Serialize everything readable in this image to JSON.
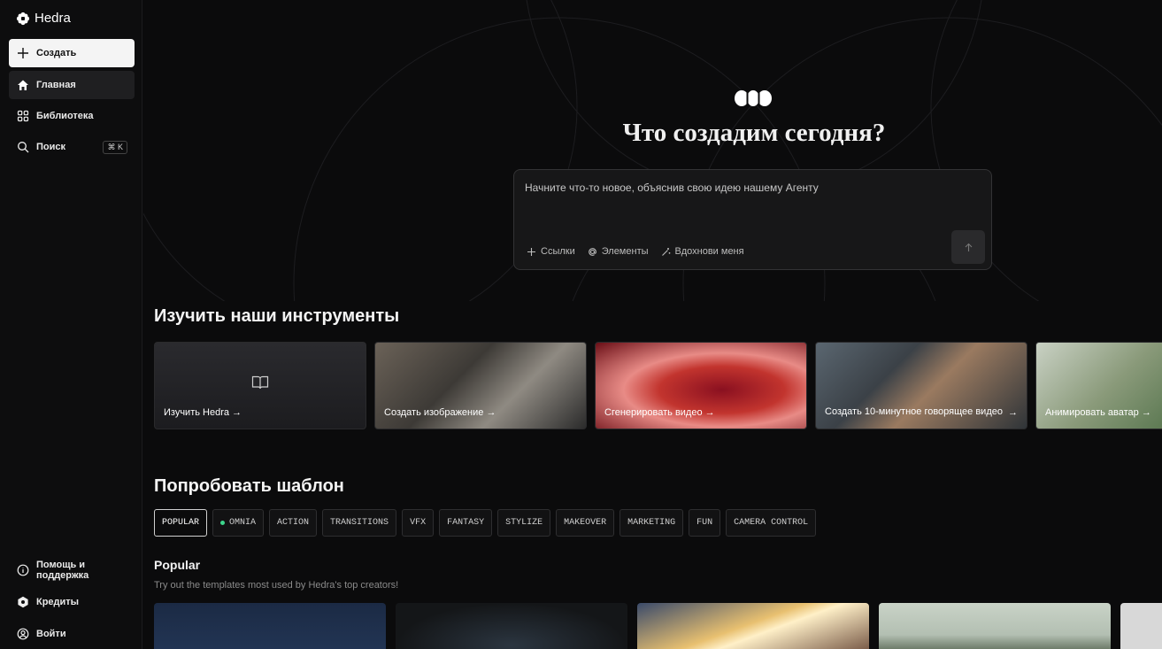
{
  "sidebar": {
    "brand": "Hedra",
    "create": "Создать",
    "home": "Главная",
    "library": "Библиотека",
    "search": "Поиск",
    "search_shortcut": "⌘ K",
    "help": "Помощь и поддержка",
    "credits": "Кредиты",
    "login": "Войти"
  },
  "hero": {
    "title": "Что создадим сегодня?",
    "prompt_placeholder": "Начните что-то новое, объяснив свою идею нашему Агенту",
    "tools": {
      "links": "Ссылки",
      "elements": "Элементы",
      "inspire": "Вдохнови меня"
    }
  },
  "tools_section": {
    "title": "Изучить наши инструменты",
    "cards": [
      {
        "label": "Изучить Hedra →"
      },
      {
        "label": "Создать изображение →"
      },
      {
        "label": "Сгенерировать видео →"
      },
      {
        "label": "Создать 10-минутное говорящее видео",
        "arrow": "→"
      },
      {
        "label": "Анимировать аватар →"
      }
    ]
  },
  "templates_section": {
    "title": "Попробовать шаблон",
    "chips": [
      "POPULAR",
      "OMNIA",
      "ACTION",
      "TRANSITIONS",
      "VFX",
      "FANTASY",
      "STYLIZE",
      "MAKEOVER",
      "MARKETING",
      "FUN",
      "CAMERA CONTROL"
    ],
    "active_chip": "POPULAR",
    "popular_title": "Popular",
    "popular_subtitle": "Try out the templates most used by Hedra's top creators!"
  },
  "colors": {
    "background": "#0b0b0c",
    "accent_dot": "#3dd68c",
    "create_button_bg": "#f4f4f4"
  }
}
